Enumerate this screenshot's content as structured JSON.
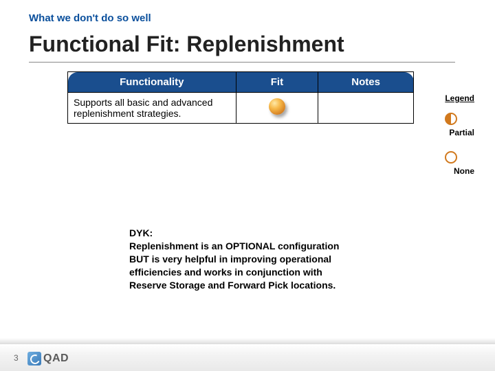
{
  "header": {
    "subtitle": "What we don't do so well",
    "title": "Functional Fit:  Replenishment"
  },
  "table": {
    "headers": [
      "Functionality",
      "Fit",
      "Notes"
    ],
    "rows": [
      {
        "functionality": "Supports all basic and advanced replenishment strategies.",
        "fit_icon": "partial-sphere",
        "notes": ""
      }
    ]
  },
  "legend": {
    "title": "Legend",
    "items": [
      {
        "icon": "partial",
        "label": "Partial"
      },
      {
        "icon": "none",
        "label": "None"
      }
    ]
  },
  "dyk": {
    "prefix": "DYK:",
    "body": "Replenishment is an OPTIONAL configuration BUT is very helpful in improving operational efficiencies and works in conjunction with Reserve Storage and Forward Pick locations."
  },
  "footer": {
    "page": "3",
    "brand": "QAD"
  }
}
